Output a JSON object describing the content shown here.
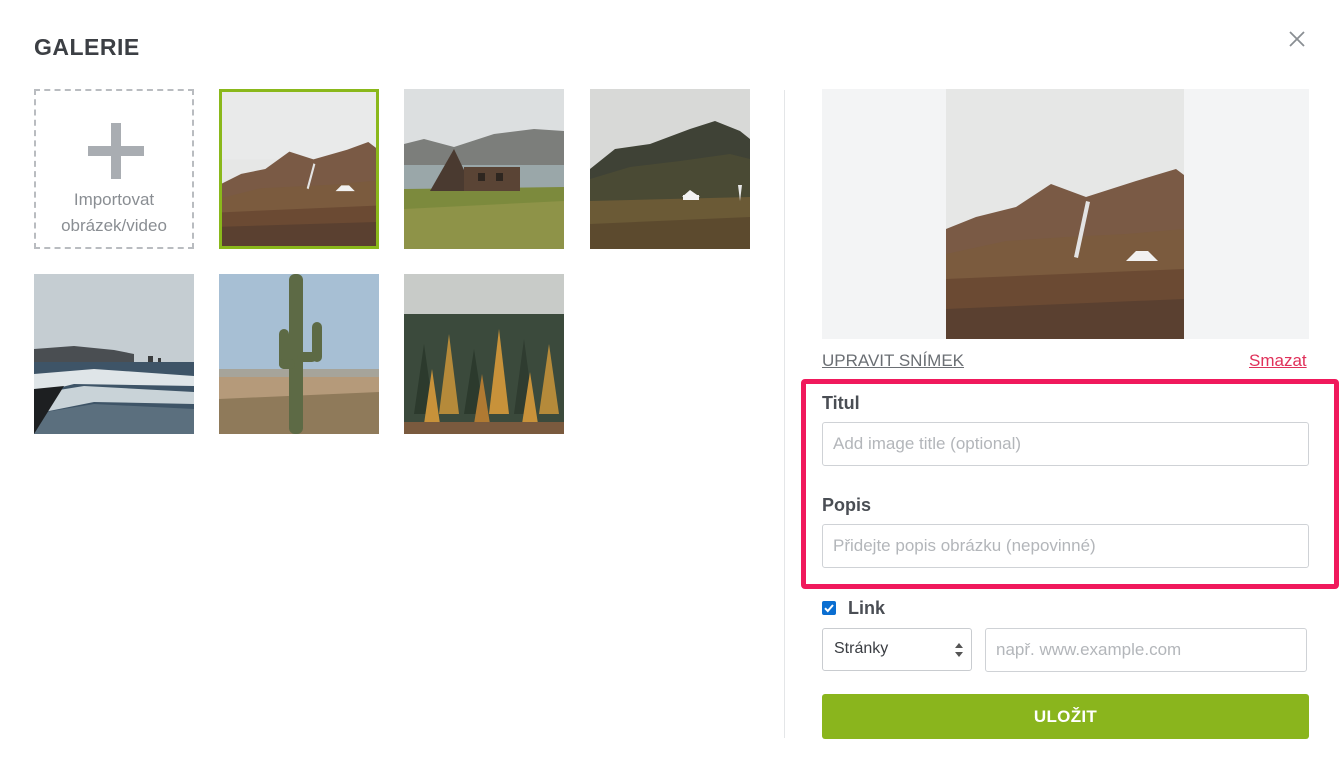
{
  "dialog": {
    "title": "GALERIE",
    "close_icon": "close-icon"
  },
  "gallery": {
    "import_label_line1": "Importovat",
    "import_label_line2": "obrázek/video",
    "images": [
      {
        "subject": "mountain valley with house and waterfall",
        "selected": true
      },
      {
        "subject": "a-frame cabin by lake"
      },
      {
        "subject": "misty mountain with white house"
      },
      {
        "subject": "ocean waves on black sand beach"
      },
      {
        "subject": "saguaro cactus in desert"
      },
      {
        "subject": "foggy autumn forest"
      }
    ]
  },
  "panel": {
    "edit_link": "UPRAVIT SNÍMEK",
    "delete_link": "Smazat",
    "title_label": "Titul",
    "title_placeholder": "Add image title (optional)",
    "title_value": "",
    "desc_label": "Popis",
    "desc_placeholder": "Přidejte popis obrázku (nepovinné)",
    "desc_value": "",
    "link_label": "Link",
    "link_checked": true,
    "link_type": "Stránky",
    "url_placeholder": "např. www.example.com",
    "save_label": "ULOŽIT"
  },
  "colors": {
    "accent": "#8ab51d",
    "highlight": "#f0195c",
    "delete": "#e0315a",
    "checkbox": "#0a6ed1"
  }
}
